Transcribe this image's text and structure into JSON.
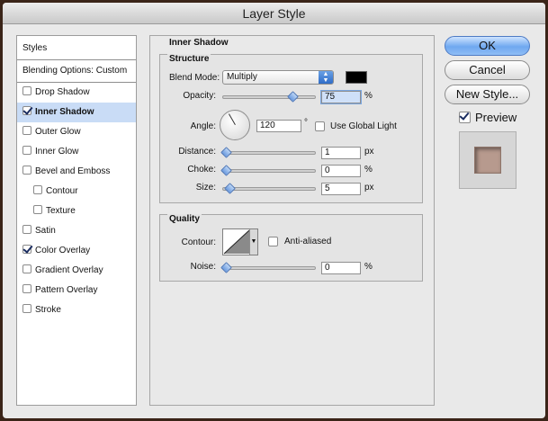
{
  "window": {
    "title": "Layer Style"
  },
  "styles_list": {
    "header": "Styles",
    "blending": "Blending Options: Custom",
    "items": [
      {
        "label": "Drop Shadow",
        "checked": false,
        "selected": false,
        "indent": false
      },
      {
        "label": "Inner Shadow",
        "checked": true,
        "selected": true,
        "indent": false
      },
      {
        "label": "Outer Glow",
        "checked": false,
        "selected": false,
        "indent": false
      },
      {
        "label": "Inner Glow",
        "checked": false,
        "selected": false,
        "indent": false
      },
      {
        "label": "Bevel and Emboss",
        "checked": false,
        "selected": false,
        "indent": false
      },
      {
        "label": "Contour",
        "checked": false,
        "selected": false,
        "indent": true
      },
      {
        "label": "Texture",
        "checked": false,
        "selected": false,
        "indent": true
      },
      {
        "label": "Satin",
        "checked": false,
        "selected": false,
        "indent": false
      },
      {
        "label": "Color Overlay",
        "checked": true,
        "selected": false,
        "indent": false
      },
      {
        "label": "Gradient Overlay",
        "checked": false,
        "selected": false,
        "indent": false
      },
      {
        "label": "Pattern Overlay",
        "checked": false,
        "selected": false,
        "indent": false
      },
      {
        "label": "Stroke",
        "checked": false,
        "selected": false,
        "indent": false
      }
    ]
  },
  "inner_shadow": {
    "title": "Inner Shadow",
    "structure": {
      "title": "Structure",
      "blend_mode_label": "Blend Mode:",
      "blend_mode_value": "Multiply",
      "shadow_color": "#000000",
      "opacity_label": "Opacity:",
      "opacity_value": "75",
      "opacity_unit": "%",
      "opacity_fraction": 0.75,
      "angle_label": "Angle:",
      "angle_value": "120",
      "angle_unit": "°",
      "use_global_light_label": "Use Global Light",
      "use_global_light": false,
      "distance_label": "Distance:",
      "distance_value": "1",
      "distance_unit": "px",
      "distance_fraction": 0.0,
      "choke_label": "Choke:",
      "choke_value": "0",
      "choke_unit": "%",
      "choke_fraction": 0.0,
      "size_label": "Size:",
      "size_value": "5",
      "size_unit": "px",
      "size_fraction": 0.04
    },
    "quality": {
      "title": "Quality",
      "contour_label": "Contour:",
      "anti_aliased_label": "Anti-aliased",
      "anti_aliased": false,
      "noise_label": "Noise:",
      "noise_value": "0",
      "noise_unit": "%",
      "noise_fraction": 0.0
    }
  },
  "buttons": {
    "ok": "OK",
    "cancel": "Cancel",
    "new_style": "New Style...",
    "preview_label": "Preview",
    "preview_checked": true,
    "preview_color": "#b79a8e"
  }
}
